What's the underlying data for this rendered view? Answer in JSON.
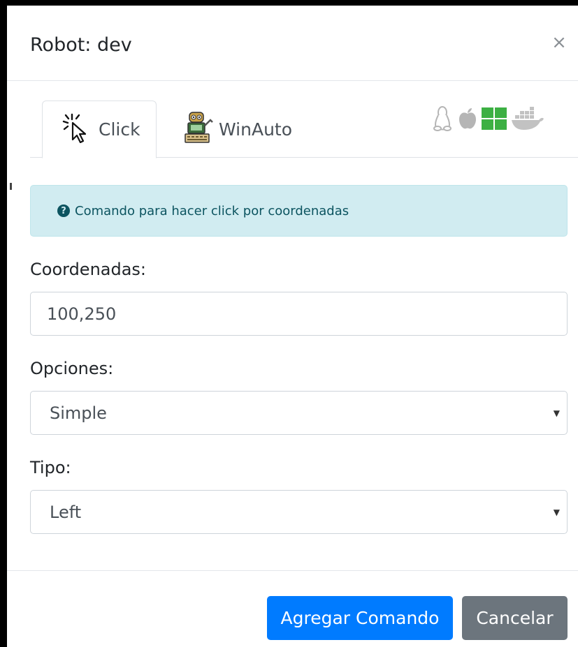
{
  "modal": {
    "title": "Robot: dev",
    "close_symbol": "×"
  },
  "tabs": [
    {
      "label": "Click",
      "icon": "cursor-click-icon",
      "active": true
    },
    {
      "label": "WinAuto",
      "icon": "robot-icon",
      "active": false
    }
  ],
  "os_icons": [
    "linux-icon",
    "apple-icon",
    "windows-icon",
    "docker-icon"
  ],
  "alert": {
    "text": "Comando para hacer click por coordenadas",
    "icon": "question-circle-icon",
    "icon_glyph": "?"
  },
  "form": {
    "coords": {
      "label": "Coordenadas:",
      "value": "100,250"
    },
    "options": {
      "label": "Opciones:",
      "selected": "Simple"
    },
    "type": {
      "label": "Tipo:",
      "selected": "Left"
    }
  },
  "footer": {
    "primary_label": "Agregar Comando",
    "secondary_label": "Cancelar"
  },
  "colors": {
    "primary": "#007bff",
    "secondary": "#6c757d",
    "alert_bg": "#d1ecf1",
    "alert_text": "#0c5460",
    "windows": "#3cb043"
  }
}
